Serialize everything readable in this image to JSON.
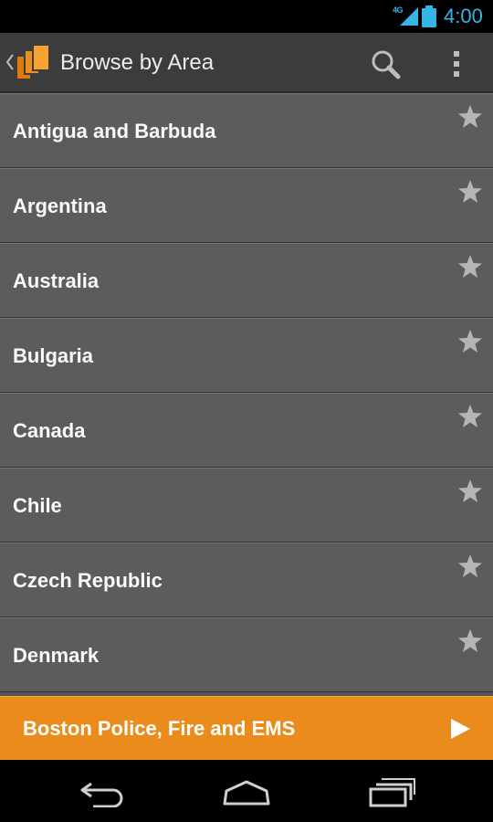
{
  "status_bar": {
    "network": "4G",
    "time": "4:00",
    "accent_color": "#34b5e5",
    "icons": [
      "signal-icon",
      "battery-icon"
    ]
  },
  "action_bar": {
    "title": "Browse by Area",
    "icons": [
      "up-chevron-icon",
      "app-logo-icon",
      "search-icon",
      "overflow-menu-icon"
    ]
  },
  "areas": [
    {
      "label": "Antigua and Barbuda",
      "icon": "star-icon"
    },
    {
      "label": "Argentina",
      "icon": "star-icon"
    },
    {
      "label": "Australia",
      "icon": "star-icon"
    },
    {
      "label": "Bulgaria",
      "icon": "star-icon"
    },
    {
      "label": "Canada",
      "icon": "star-icon"
    },
    {
      "label": "Chile",
      "icon": "star-icon"
    },
    {
      "label": "Czech Republic",
      "icon": "star-icon"
    },
    {
      "label": "Denmark",
      "icon": "star-icon"
    }
  ],
  "now_playing": {
    "label": "Boston Police, Fire and EMS",
    "icon": "play-icon",
    "color": "#ea8b1c"
  },
  "nav_bar": {
    "icons": [
      "back-icon",
      "home-icon",
      "recent-apps-icon"
    ]
  }
}
